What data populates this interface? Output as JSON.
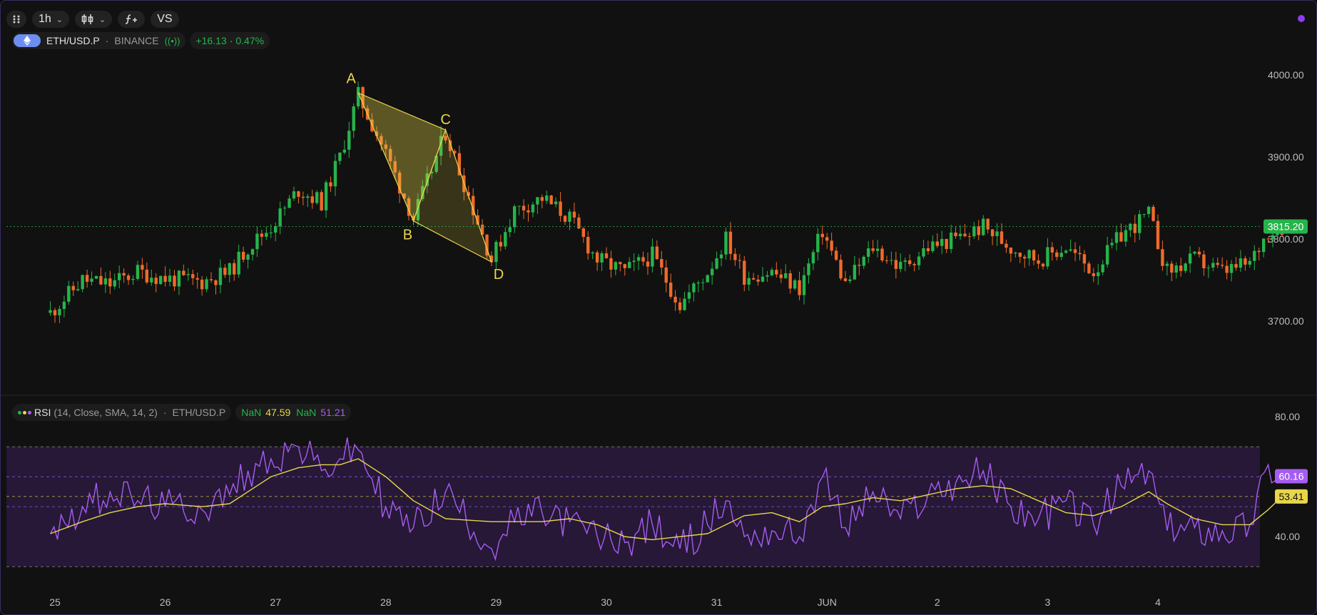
{
  "toolbar": {
    "grid_icon": "grid-icon",
    "interval": "1h",
    "chart_type_icon": "candles-icon",
    "indicators_icon": "function-icon",
    "compare": "VS"
  },
  "symbol": {
    "name": "ETH/USD.P",
    "exchange": "BINANCE",
    "change": "+16.13",
    "change_pct": "0.47%",
    "separator": "·"
  },
  "colors": {
    "up": "#26b44a",
    "down": "#f06a2a",
    "pattern": "#e8d64a",
    "rsi": "#a65cf2",
    "rsi_sma": "#e8d64a",
    "rsi_band": "#2a1a3d"
  },
  "price_axis": {
    "labels": [
      "4000.00",
      "3900.00",
      "3800.00",
      "3700.00"
    ],
    "last_price": "3815.20"
  },
  "pattern": {
    "points": [
      {
        "label": "A",
        "date": "May 27 18:00",
        "price": 3978
      },
      {
        "label": "B",
        "date": "May 28 06:00",
        "price": 3822
      },
      {
        "label": "C",
        "date": "May 28 13:00",
        "price": 3933
      },
      {
        "label": "D",
        "date": "May 28 23:00",
        "price": 3772
      }
    ]
  },
  "rsi": {
    "title": "RSI",
    "params": "(14, Close, SMA, 14, 2)",
    "symbol": "ETH/USD.P",
    "v1": "NaN",
    "v2": "47.59",
    "v3": "NaN",
    "v4": "51.21",
    "axis_labels": [
      "80.00",
      "40.00"
    ],
    "rsi_value": "60.16",
    "sma_value": "53.41"
  },
  "x_axis": {
    "labels": [
      "25",
      "26",
      "27",
      "28",
      "29",
      "30",
      "31",
      "JUN",
      "2",
      "3",
      "4"
    ]
  },
  "chart_data": [
    {
      "type": "candlestick",
      "title": "ETH/USD.P · BINANCE · 1h",
      "x_labels": [
        "25",
        "26",
        "27",
        "28",
        "29",
        "30",
        "31",
        "JUN",
        "2",
        "3",
        "4"
      ],
      "ylim": [
        3640,
        4040
      ],
      "y_ticks": [
        4000,
        3900,
        3800,
        3700
      ],
      "last_price": 3815.2,
      "close_path": [
        [
          "May 24 23:00",
          3710
        ],
        [
          "May 25 06:00",
          3750
        ],
        [
          "May 25 12:00",
          3745
        ],
        [
          "May 25 18:00",
          3760
        ],
        [
          "May 26 00:00",
          3752
        ],
        [
          "May 26 08:00",
          3748
        ],
        [
          "May 26 14:00",
          3760
        ],
        [
          "May 26 18:00",
          3790
        ],
        [
          "May 26 23:00",
          3815
        ],
        [
          "May 27 05:00",
          3860
        ],
        [
          "May 27 10:00",
          3845
        ],
        [
          "May 27 14:00",
          3900
        ],
        [
          "May 27 18:00",
          3975
        ],
        [
          "May 28 00:00",
          3905
        ],
        [
          "May 28 06:00",
          3825
        ],
        [
          "May 28 13:00",
          3930
        ],
        [
          "May 28 23:00",
          3775
        ],
        [
          "May 29 04:00",
          3835
        ],
        [
          "May 29 10:00",
          3850
        ],
        [
          "May 29 16:00",
          3825
        ],
        [
          "May 29 22:00",
          3775
        ],
        [
          "May 30 04:00",
          3760
        ],
        [
          "May 30 10:00",
          3780
        ],
        [
          "May 30 16:00",
          3720
        ],
        [
          "May 30 22:00",
          3760
        ],
        [
          "May 31 02:00",
          3800
        ],
        [
          "May 31 06:00",
          3755
        ],
        [
          "May 31 12:00",
          3760
        ],
        [
          "May 31 18:00",
          3740
        ],
        [
          "May 31 23:00",
          3810
        ],
        [
          "Jun 1 04:00",
          3745
        ],
        [
          "Jun 1 10:00",
          3790
        ],
        [
          "Jun 1 16:00",
          3765
        ],
        [
          "Jun 1 22:00",
          3790
        ],
        [
          "Jun 2 04:00",
          3800
        ],
        [
          "Jun 2 10:00",
          3815
        ],
        [
          "Jun 2 16:00",
          3790
        ],
        [
          "Jun 2 22:00",
          3775
        ],
        [
          "Jun 3 04:00",
          3790
        ],
        [
          "Jun 3 10:00",
          3760
        ],
        [
          "Jun 3 16:00",
          3805
        ],
        [
          "Jun 3 22:00",
          3830
        ],
        [
          "Jun 4 02:00",
          3760
        ],
        [
          "Jun 4 08:00",
          3775
        ],
        [
          "Jun 4 14:00",
          3760
        ],
        [
          "Jun 4 20:00",
          3770
        ],
        [
          "Jun 5 00:00",
          3810
        ],
        [
          "Jun 5 03:00",
          3815
        ]
      ]
    },
    {
      "type": "line",
      "title": "RSI (14, Close, SMA, 14, 2)",
      "ylim": [
        26,
        86
      ],
      "y_ticks": [
        80,
        40
      ],
      "levels": [
        70,
        60,
        53.41,
        50,
        30
      ],
      "series": [
        {
          "name": "RSI",
          "points": [
            [
              "May 24 23:00",
              41
            ],
            [
              "May 25 06:00",
              50
            ],
            [
              "May 25 12:00",
              55
            ],
            [
              "May 25 18:00",
              52
            ],
            [
              "May 26 00:00",
              50
            ],
            [
              "May 26 08:00",
              49
            ],
            [
              "May 26 14:00",
              54
            ],
            [
              "May 26 18:00",
              62
            ],
            [
              "May 26 23:00",
              66
            ],
            [
              "May 27 05:00",
              70
            ],
            [
              "May 27 10:00",
              62
            ],
            [
              "May 27 14:00",
              66
            ],
            [
              "May 27 18:00",
              69
            ],
            [
              "May 28 00:00",
              50
            ],
            [
              "May 28 06:00",
              43
            ],
            [
              "May 28 13:00",
              55
            ],
            [
              "May 28 23:00",
              36
            ],
            [
              "May 29 04:00",
              45
            ],
            [
              "May 29 10:00",
              48
            ],
            [
              "May 29 16:00",
              45
            ],
            [
              "May 29 22:00",
              40
            ],
            [
              "May 30 04:00",
              38
            ],
            [
              "May 30 10:00",
              44
            ],
            [
              "May 30 16:00",
              36
            ],
            [
              "May 30 22:00",
              44
            ],
            [
              "May 31 02:00",
              52
            ],
            [
              "May 31 06:00",
              40
            ],
            [
              "May 31 12:00",
              42
            ],
            [
              "May 31 18:00",
              40
            ],
            [
              "May 31 23:00",
              60
            ],
            [
              "Jun 1 04:00",
              43
            ],
            [
              "Jun 1 10:00",
              55
            ],
            [
              "Jun 1 16:00",
              46
            ],
            [
              "Jun 1 22:00",
              54
            ],
            [
              "Jun 2 04:00",
              58
            ],
            [
              "Jun 2 10:00",
              62
            ],
            [
              "Jun 2 16:00",
              50
            ],
            [
              "Jun 2 22:00",
              46
            ],
            [
              "Jun 3 04:00",
              52
            ],
            [
              "Jun 3 10:00",
              44
            ],
            [
              "Jun 3 16:00",
              57
            ],
            [
              "Jun 3 22:00",
              62
            ],
            [
              "Jun 4 02:00",
              42
            ],
            [
              "Jun 4 08:00",
              43
            ],
            [
              "Jun 4 14:00",
              42
            ],
            [
              "Jun 4 20:00",
              44
            ],
            [
              "Jun 5 00:00",
              64
            ],
            [
              "Jun 5 03:00",
              60.16
            ]
          ]
        },
        {
          "name": "RSI SMA",
          "points": [
            [
              "May 24 23:00",
              41
            ],
            [
              "May 25 06:00",
              45
            ],
            [
              "May 25 12:00",
              48
            ],
            [
              "May 25 18:00",
              50
            ],
            [
              "May 26 00:00",
              51
            ],
            [
              "May 26 08:00",
              50
            ],
            [
              "May 26 14:00",
              51
            ],
            [
              "May 26 18:00",
              55
            ],
            [
              "May 26 23:00",
              60
            ],
            [
              "May 27 05:00",
              63
            ],
            [
              "May 27 10:00",
              64
            ],
            [
              "May 27 14:00",
              64
            ],
            [
              "May 27 18:00",
              66
            ],
            [
              "May 28 00:00",
              60
            ],
            [
              "May 28 06:00",
              52
            ],
            [
              "May 28 13:00",
              46
            ],
            [
              "May 28 23:00",
              45
            ],
            [
              "May 29 04:00",
              45
            ],
            [
              "May 29 10:00",
              45
            ],
            [
              "May 29 16:00",
              46
            ],
            [
              "May 29 22:00",
              44
            ],
            [
              "May 30 04:00",
              40
            ],
            [
              "May 30 10:00",
              39
            ],
            [
              "May 30 16:00",
              40
            ],
            [
              "May 30 22:00",
              41
            ],
            [
              "May 31 02:00",
              44
            ],
            [
              "May 31 06:00",
              47
            ],
            [
              "May 31 12:00",
              48
            ],
            [
              "May 31 18:00",
              45
            ],
            [
              "May 31 23:00",
              50
            ],
            [
              "Jun 1 04:00",
              51
            ],
            [
              "Jun 1 10:00",
              53
            ],
            [
              "Jun 1 16:00",
              52
            ],
            [
              "Jun 1 22:00",
              54
            ],
            [
              "Jun 2 04:00",
              56
            ],
            [
              "Jun 2 10:00",
              57
            ],
            [
              "Jun 2 16:00",
              56
            ],
            [
              "Jun 2 22:00",
              52
            ],
            [
              "Jun 3 04:00",
              48
            ],
            [
              "Jun 3 10:00",
              47
            ],
            [
              "Jun 3 16:00",
              50
            ],
            [
              "Jun 3 22:00",
              55
            ],
            [
              "Jun 4 02:00",
              51
            ],
            [
              "Jun 4 08:00",
              46
            ],
            [
              "Jun 4 14:00",
              44
            ],
            [
              "Jun 4 20:00",
              44
            ],
            [
              "Jun 5 00:00",
              49
            ],
            [
              "Jun 5 03:00",
              53.41
            ]
          ]
        }
      ]
    }
  ]
}
